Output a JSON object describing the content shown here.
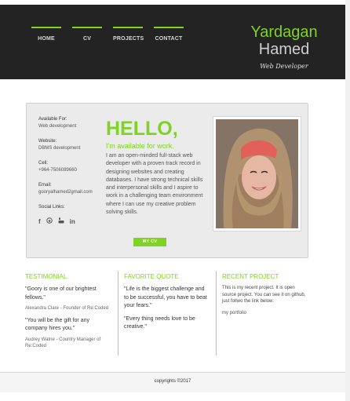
{
  "nav": {
    "items": [
      {
        "label": "HOME"
      },
      {
        "label": "CV"
      },
      {
        "label": "PROJECTS"
      },
      {
        "label": "CONTACT"
      }
    ]
  },
  "brand": {
    "first_name": "Yardagan",
    "last_name": "Hamed",
    "role": "Web Developer"
  },
  "info": {
    "available_label": "Available For:",
    "available_value": "Web development",
    "website_label": "Website:",
    "website_value": "DBMS development",
    "cell_label": "Cell:",
    "cell_value": "+964-7506089660",
    "email_label": "Email:",
    "email_value": "gooryalhamed2gmail.com",
    "links_label": "Social Links:",
    "social_icons": [
      "facebook-icon",
      "github-icon",
      "youtube-icon",
      "linkedin-icon"
    ]
  },
  "intro": {
    "hello": "HELLO,",
    "available": "I'm available for work.",
    "bio": "I am an open-minded full-stack web developer with a proven track record in designing websites and creating databases. I have strong technical skills and interpersonal skills and I aspire to work in a challenging team environment where I can use my creative problem solving skills.",
    "cv_button": "MY CV"
  },
  "testimonial": {
    "title": "TESTIMONIAL",
    "quote1": "\"Goory is one of our brightest fellows.\"",
    "author1": "Alexandra Clare - Founder of Re:Coded",
    "quote2": "\"You will be the gift for any company hires you.\"",
    "author2": "Audrey Watne - Country Manager of Re:Coded"
  },
  "favorite_quote": {
    "title": "FAVORITE QUOTE",
    "quote1": "\"Life is the biggest challenge and to be successful, you have to beat your fears.\"",
    "quote2": "\"Every thing needs love to be creative.\""
  },
  "recent_project": {
    "title": "RECENT PROJECT",
    "description": "This is my recent project. It is open source project. You can see it on github, just follwo the link below:",
    "link": "my portfolio"
  },
  "footer": {
    "copyright": "copyrights ©2017"
  },
  "colors": {
    "accent": "#7fd321",
    "header_bg": "#232323"
  }
}
